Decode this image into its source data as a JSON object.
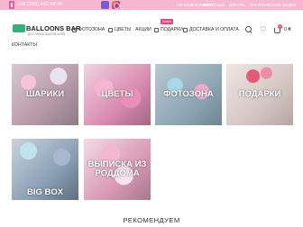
{
  "topbar": {
    "phone": "+38 (050) 452 58 00",
    "nav": [
      "ЛИЧНЫЙ КАБИНЕТ",
      "ОБРАТНЫЙ",
      "ДОРОГА",
      "ПРАКТИЧЕСКИЕ ВИДЕО"
    ]
  },
  "logo": {
    "name": "BALLOONS BAR",
    "tagline": "ДОСТАВКА ШАРОВ КИЕВ"
  },
  "menu": {
    "items": [
      "ФОТОЗОНА",
      "ЦВЕТЫ",
      "АКЦИИ",
      "ПОДАРКИ",
      "ДОСТАВКА И ОПЛАТА"
    ],
    "badge": "Новое",
    "contacts": "КОНТАКТЫ"
  },
  "cart": {
    "count": "0",
    "price": "0 ₴"
  },
  "icons": [
    "phone-icon",
    "viber-icon",
    "instagram-icon",
    "search-icon",
    "heart-icon",
    "cart-icon"
  ],
  "categories": [
    "ШАРИКИ",
    "ЦВЕТЫ",
    "ФОТОЗОНА",
    "ПОДАРКИ",
    "BIG BOX",
    "ВЫПИСКА ИЗ РОДДОМА"
  ],
  "section_title": "РЕКОМЕНДУЕМ",
  "colors": {
    "accent": "#e8417d",
    "topbar": "#f7b7cf",
    "logo": "#2bb673"
  }
}
